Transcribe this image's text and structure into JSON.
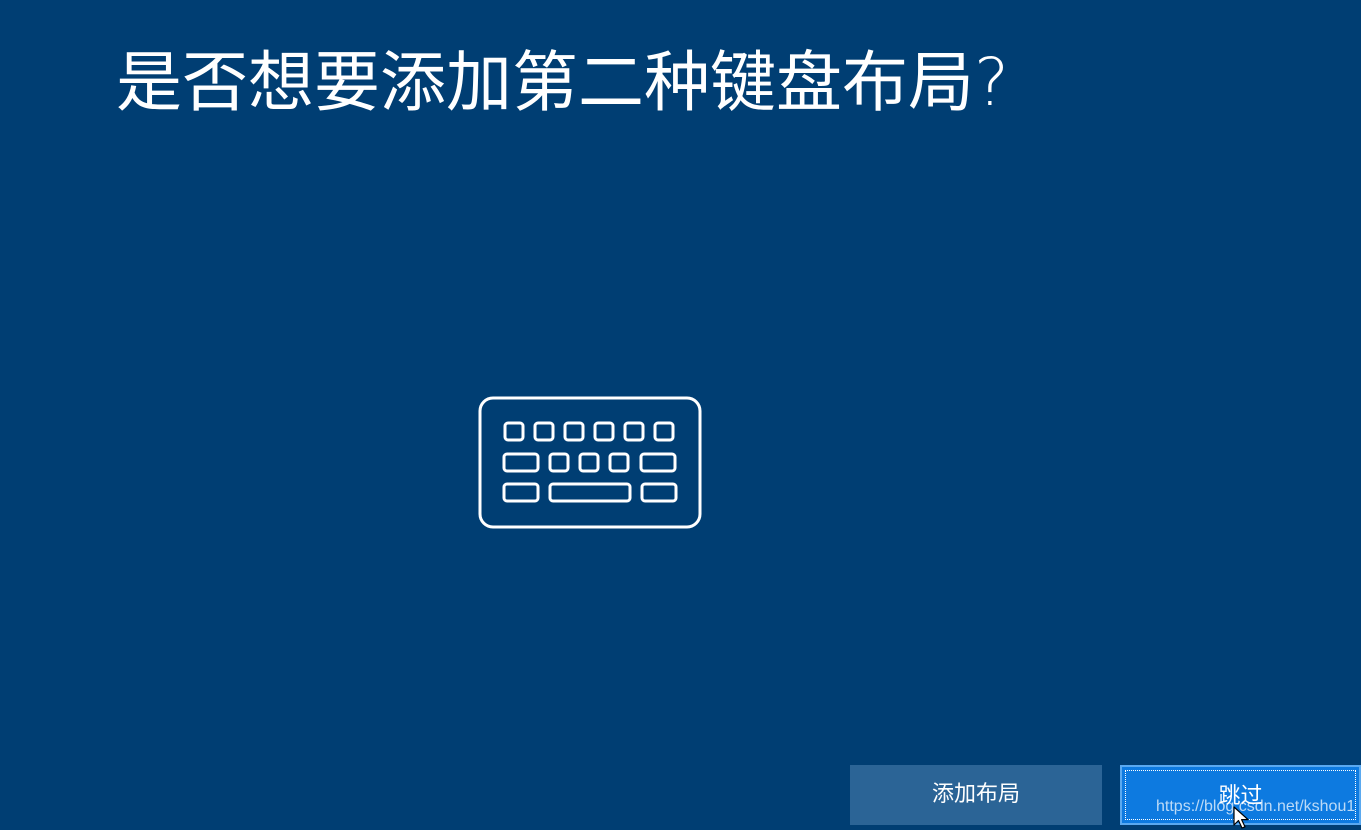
{
  "page": {
    "title": "是否想要添加第二种键盘布局?"
  },
  "illustration": {
    "icon": "keyboard-icon"
  },
  "actions": {
    "add_layout_label": "添加布局",
    "skip_label": "跳过"
  },
  "watermark": {
    "text": "https://blog.csdn.net/kshou1"
  },
  "colors": {
    "background": "#003e73",
    "secondary_button": "#2b6496",
    "primary_button": "#0d7ae0"
  }
}
